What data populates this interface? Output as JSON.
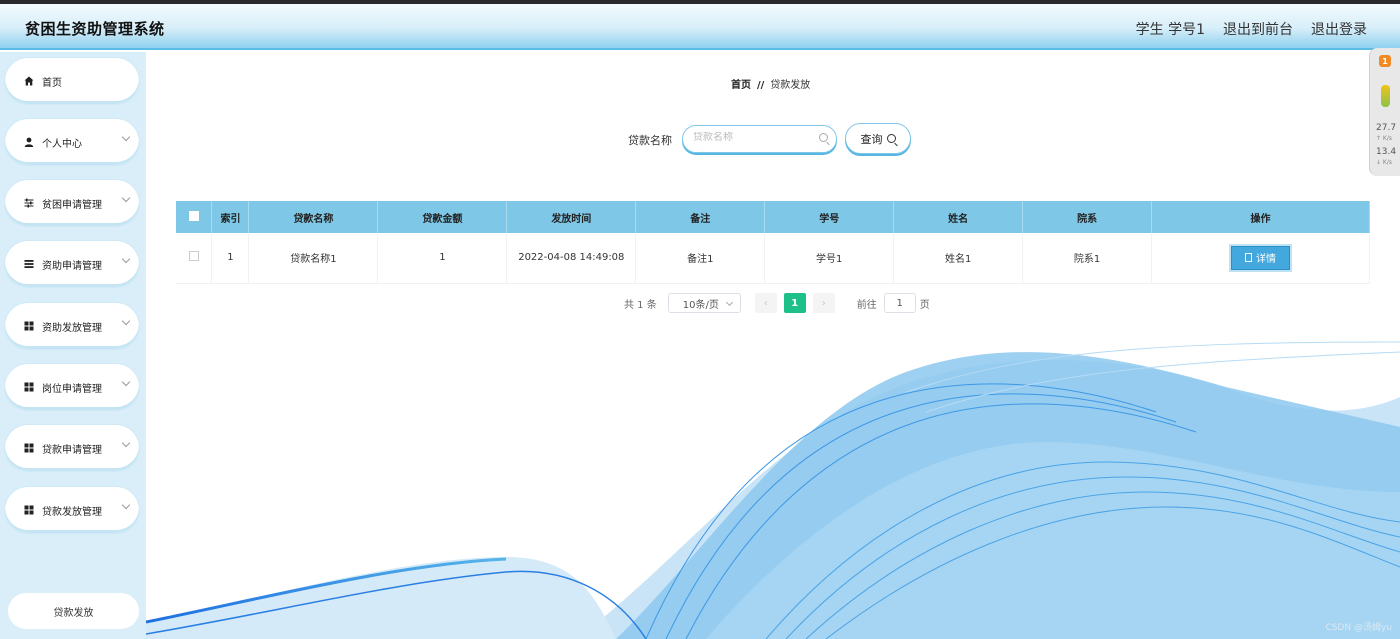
{
  "header": {
    "title": "贫困生资助管理系统",
    "user": "学生 学号1",
    "to_front": "退出到前台",
    "logout": "退出登录"
  },
  "sidebar": {
    "items": [
      {
        "label": "首页",
        "icon": "home-icon"
      },
      {
        "label": "个人中心",
        "icon": "user-icon"
      },
      {
        "label": "贫困申请管理",
        "icon": "sliders-icon"
      },
      {
        "label": "资助申请管理",
        "icon": "list-icon"
      },
      {
        "label": "资助发放管理",
        "icon": "grid-icon"
      },
      {
        "label": "岗位申请管理",
        "icon": "grid-icon"
      },
      {
        "label": "贷款申请管理",
        "icon": "grid-icon"
      },
      {
        "label": "贷款发放管理",
        "icon": "grid-icon"
      }
    ],
    "submenu": [
      "贷款发放"
    ]
  },
  "breadcrumb": {
    "home": "首页",
    "separator": "//",
    "current": "贷款发放"
  },
  "search": {
    "label": "贷款名称",
    "placeholder": "贷款名称",
    "button": "查询"
  },
  "table": {
    "headers": [
      "索引",
      "贷款名称",
      "贷款金额",
      "发放时间",
      "备注",
      "学号",
      "姓名",
      "院系",
      "操作"
    ],
    "rows": [
      {
        "index": "1",
        "name": "贷款名称1",
        "amount": "1",
        "time": "2022-04-08 14:49:08",
        "remark": "备注1",
        "student_no": "学号1",
        "student_name": "姓名1",
        "department": "院系1",
        "action": "详情"
      }
    ]
  },
  "pagination": {
    "total": "共 1 条",
    "page_size": "10条/页",
    "prev": "‹",
    "current": "1",
    "next": "›",
    "goto": "前往",
    "goto_value": "1",
    "page_suffix": "页"
  },
  "widget": {
    "badge": "1",
    "upload_value": "27.7",
    "upload_unit": "↑ K/s",
    "download_value": "13.4",
    "download_unit": "↓ K/s"
  },
  "watermark": "CSDN @汤姆yu",
  "colors": {
    "header_accent": "#5bbde6",
    "table_header": "#7ec7e6",
    "detail_button": "#42a8de",
    "active_page": "#1ec08a",
    "sidebar_bg": "#d9eef8"
  }
}
